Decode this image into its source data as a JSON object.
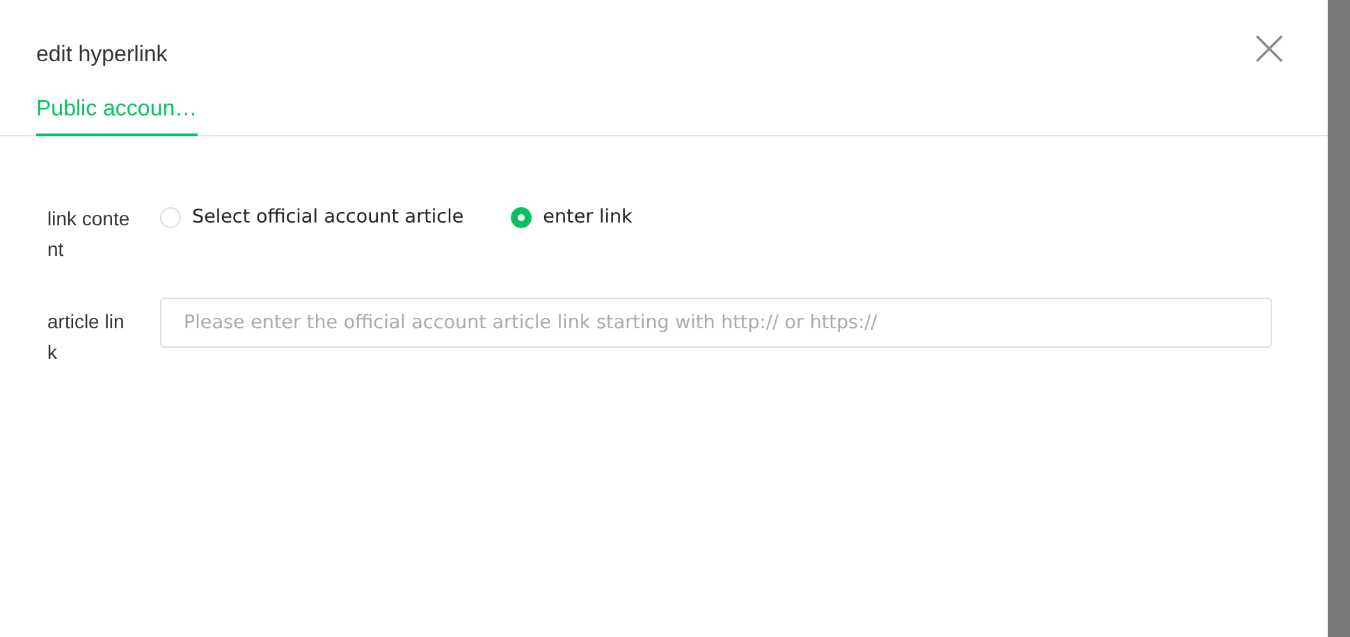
{
  "dialog": {
    "title": "edit hyperlink"
  },
  "tabs": [
    {
      "label": "Public accoun…",
      "selected": true
    }
  ],
  "form": {
    "rows": [
      {
        "kind": "radio",
        "label": "link content",
        "options": [
          {
            "label": "Select official account article",
            "selected": false
          },
          {
            "label": "enter link",
            "selected": true
          }
        ]
      },
      {
        "kind": "input",
        "label": "article link",
        "placeholder": "Please enter the official account article link starting with http:// or https://"
      }
    ]
  }
}
